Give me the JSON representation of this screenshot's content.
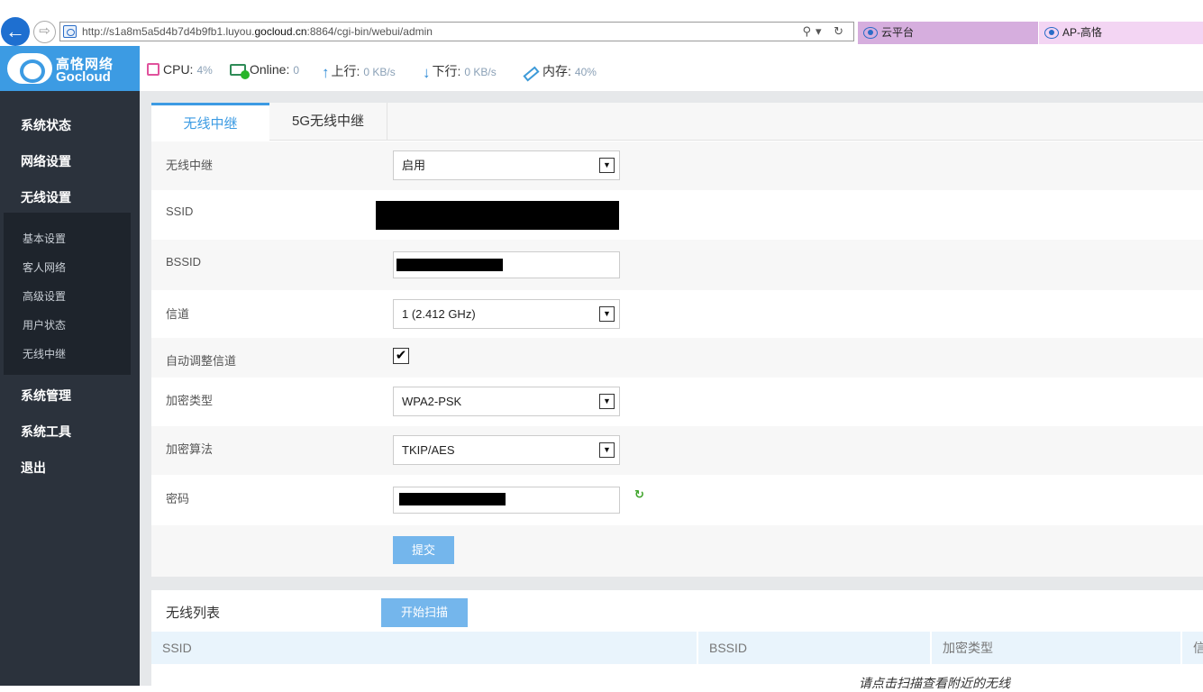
{
  "browser": {
    "url_prefix": "http://s1a8m5a5d4b7d4b9fb1.luyou.",
    "url_domain": "gocloud.cn",
    "url_suffix": ":8864/cgi-bin/webui/admin",
    "url_tools": "⚲▾ ↻",
    "tabs": [
      {
        "label": "云平台"
      },
      {
        "label": "AP-高恪"
      }
    ]
  },
  "brand": {
    "name_cn": "高恪网络",
    "name_en": "Gocloud"
  },
  "status": {
    "cpu_label": "CPU:",
    "cpu_value": "4%",
    "online_label": "Online:",
    "online_value": "0",
    "up_label": "上行:",
    "up_value": "0 KB/s",
    "down_label": "下行:",
    "down_value": "0 KB/s",
    "mem_label": "内存:",
    "mem_value": "40%"
  },
  "sidebar": {
    "main": [
      "系统状态",
      "网络设置",
      "无线设置",
      "系统管理",
      "系统工具",
      "退出"
    ],
    "sub": [
      "基本设置",
      "客人网络",
      "高级设置",
      "用户状态",
      "无线中继"
    ]
  },
  "tabs": {
    "repeater": "无线中继",
    "repeater_5g": "5G无线中继"
  },
  "form": {
    "enable_label": "无线中继",
    "enable_value": "启用",
    "ssid_label": "SSID",
    "bssid_label": "BSSID",
    "channel_label": "信道",
    "channel_value": "1 (2.412 GHz)",
    "auto_channel_label": "自动调整信道",
    "auto_channel_checked": true,
    "enc_type_label": "加密类型",
    "enc_type_value": "WPA2-PSK",
    "enc_algo_label": "加密算法",
    "enc_algo_value": "TKIP/AES",
    "password_label": "密码",
    "submit_label": "提交"
  },
  "wireless_list": {
    "title": "无线列表",
    "scan_label": "开始扫描",
    "columns": [
      "SSID",
      "BSSID",
      "加密类型",
      "信"
    ],
    "empty_message": "请点击扫描查看附近的无线"
  }
}
